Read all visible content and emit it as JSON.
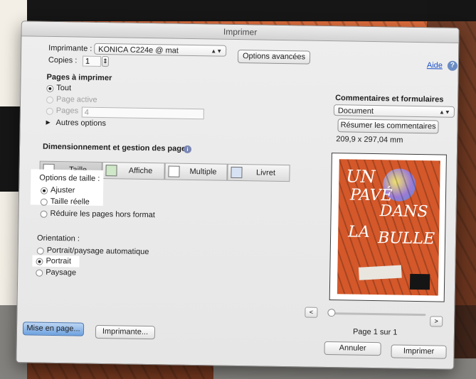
{
  "window": {
    "title": "Imprimer"
  },
  "printer": {
    "label": "Imprimante :",
    "value": "KONICA C224e @ mat"
  },
  "copies": {
    "label": "Copies :",
    "value": "1"
  },
  "advanced_button": "Options avancées",
  "help": {
    "label": "Aide",
    "icon": "help-icon"
  },
  "pages": {
    "heading": "Pages à imprimer",
    "options": [
      {
        "label": "Tout",
        "selected": true,
        "enabled": true
      },
      {
        "label": "Page active",
        "selected": false,
        "enabled": false
      },
      {
        "label": "Pages",
        "selected": false,
        "enabled": false
      }
    ],
    "pages_value": "4",
    "more": "Autres options"
  },
  "sizing": {
    "heading": "Dimensionnement et gestion des pages",
    "tabs": [
      "Taille",
      "Affiche",
      "Multiple",
      "Livret"
    ],
    "selected_tab": "Taille",
    "size_options_label": "Options de taille :",
    "size_options": [
      {
        "label": "Ajuster",
        "selected": true
      },
      {
        "label": "Taille réelle",
        "selected": false
      },
      {
        "label": "Réduire les pages hors format",
        "selected": false
      }
    ],
    "orientation_label": "Orientation :",
    "orientation_options": [
      {
        "label": "Portrait/paysage automatique",
        "selected": false
      },
      {
        "label": "Portrait",
        "selected": true
      },
      {
        "label": "Paysage",
        "selected": false
      }
    ]
  },
  "comments": {
    "heading": "Commentaires et formulaires",
    "select_value": "Document",
    "summary_button": "Résumer les commentaires",
    "page_size": "209,9 x 297,04 mm"
  },
  "preview": {
    "poster_lines": [
      "UN",
      "PAVÉ",
      "DANS",
      "LA",
      "BULLE"
    ],
    "page_info": "Page 1 sur 1",
    "prev": "<",
    "next": ">"
  },
  "footer": {
    "page_setup": "Mise en page...",
    "printer_button": "Imprimante...",
    "cancel": "Annuler",
    "print": "Imprimer"
  },
  "colors": {
    "accent": "#6ea2e0",
    "background": "#d9622f"
  }
}
